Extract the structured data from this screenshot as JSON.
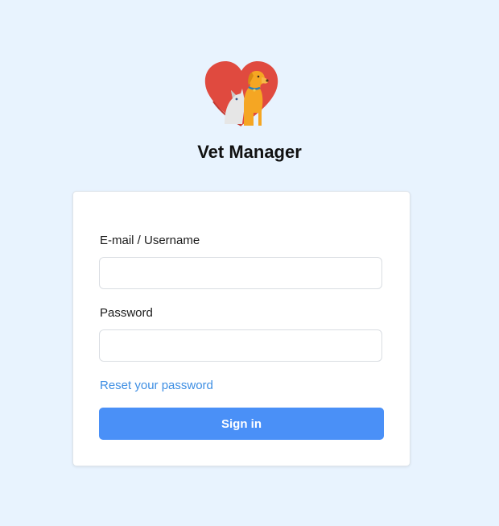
{
  "app": {
    "title": "Vet Manager",
    "logo_icon": "heart-dog-cat-logo-icon"
  },
  "login_form": {
    "username_label": "E-mail / Username",
    "username_value": "",
    "username_placeholder": "",
    "password_label": "Password",
    "password_value": "",
    "password_placeholder": "",
    "reset_link_label": "Reset your password",
    "signin_label": "Sign in"
  },
  "colors": {
    "background": "#e8f3fe",
    "card": "#ffffff",
    "link": "#3d8ee3",
    "primary_button": "#4a90f7",
    "logo_heart": "#e04a3f",
    "logo_dog": "#f5a623"
  }
}
